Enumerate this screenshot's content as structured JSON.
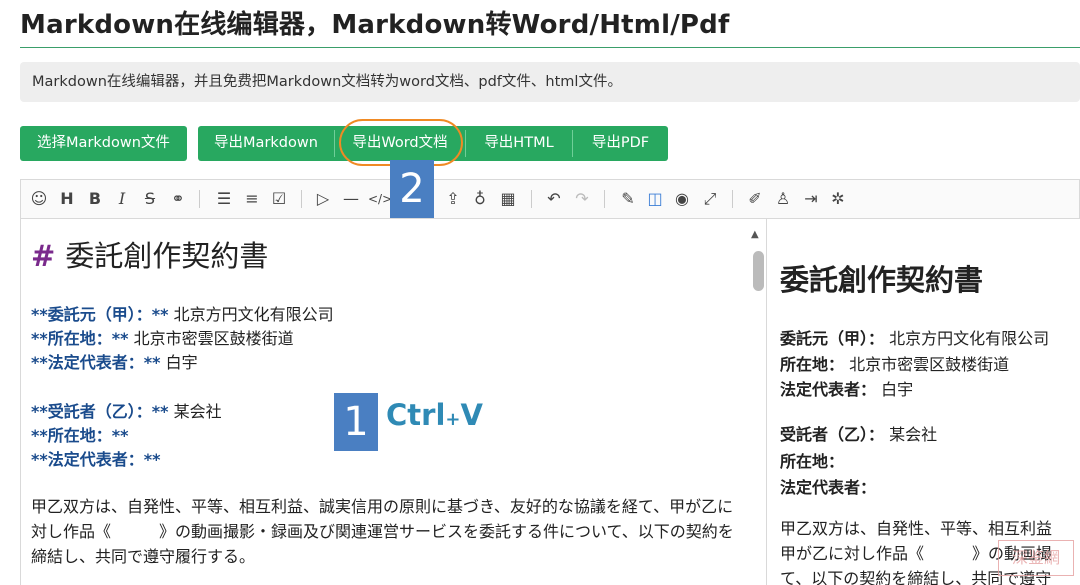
{
  "page": {
    "title": "Markdown在线编辑器，Markdown转Word/Html/Pdf",
    "description": "Markdown在线编辑器，并且免费把Markdown文档转为word文档、pdf文件、html文件。"
  },
  "actions": {
    "choose_file": "选择Markdown文件",
    "export_markdown": "导出Markdown",
    "export_word": "导出Word文档",
    "export_html": "导出HTML",
    "export_pdf": "导出PDF"
  },
  "annotations": {
    "badge_1": "1",
    "badge_2": "2",
    "shortcut_main": "Ctrl",
    "shortcut_plus": "+",
    "shortcut_key": "V"
  },
  "toolbar_icons": [
    "emoji-icon",
    "heading-icon",
    "bold-icon",
    "italic-icon",
    "strikethrough-icon",
    "link-icon",
    "unordered-list-icon",
    "ordered-list-icon",
    "checklist-icon",
    "quote-icon",
    "horizontal-rule-icon",
    "code-icon",
    "upload-icon",
    "record-icon",
    "table-icon",
    "undo-icon",
    "redo-icon",
    "edit-mode-icon",
    "split-mode-icon",
    "preview-icon",
    "fullscreen-icon",
    "format-icon",
    "theme-icon",
    "export-icon",
    "debug-icon"
  ],
  "editor": {
    "h1_hash": "#",
    "h1_text": "委託創作契約書",
    "lines": [
      {
        "pre": "**",
        "key": "委託元（甲）：",
        "post": "** 北京方円文化有限公司"
      },
      {
        "pre": "**",
        "key": "所在地：",
        "post": "** 北京市密雲区鼓楼街道"
      },
      {
        "pre": "**",
        "key": "法定代表者：",
        "post": "** 白宇"
      },
      {
        "pre": "**",
        "key": "受託者（乙）：",
        "post": "** 某会社"
      },
      {
        "pre": "**",
        "key": "所在地：",
        "post": "**"
      },
      {
        "pre": "**",
        "key": "法定代表者：",
        "post": "**"
      }
    ],
    "paragraph": "甲乙双方は、自発性、平等、相互利益、誠実信用の原則に基づき、友好的な協議を経て、甲が乙に対し作品《　　　》の動画撮影・録画及び関連運営サービスを委託する件について、以下の契約を締結し、共同で遵守履行する。"
  },
  "preview": {
    "h1_text": "委託創作契約書",
    "lines": [
      {
        "key": "委託元（甲）：",
        "val": " 北京方円文化有限公司"
      },
      {
        "key": "所在地：",
        "val": " 北京市密雲区鼓楼街道"
      },
      {
        "key": "法定代表者：",
        "val": " 白宇"
      },
      {
        "key": "受託者（乙）：",
        "val": " 某会社"
      },
      {
        "key": "所在地：",
        "val": ""
      },
      {
        "key": "法定代表者：",
        "val": ""
      }
    ],
    "para_lines": [
      "甲乙双方は、自発性、平等、相互利益",
      "甲が乙に対し作品《　　　》の動画撮",
      "て、以下の契約を締結し、共同で遵守"
    ]
  },
  "watermark": "深鉴網"
}
